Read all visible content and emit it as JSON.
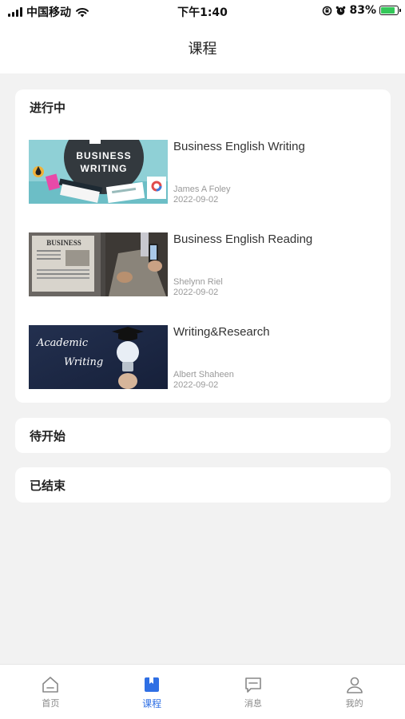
{
  "status_bar": {
    "carrier": "中国移动",
    "time": "下午1:40",
    "battery": "83%",
    "battery_level": 0.83,
    "icons": [
      "signal-icon",
      "wifi-icon",
      "rotation-lock-icon",
      "alarm-icon",
      "battery-charging-icon"
    ]
  },
  "header": {
    "title": "课程"
  },
  "sections": {
    "in_progress": {
      "title": "进行中",
      "courses": [
        {
          "title": "Business English Writing",
          "teacher": "James A Foley",
          "date": "2022-09-02",
          "thumb_text_1": "BUSINESS",
          "thumb_text_2": "WRITING"
        },
        {
          "title": "Business English Reading",
          "teacher": "Shelynn Riel",
          "date": "2022-09-02",
          "thumb_text_1": "BUSINESS"
        },
        {
          "title": "Writing&Research",
          "teacher": "Albert Shaheen",
          "date": "2022-09-02",
          "thumb_text_1": "Academic",
          "thumb_text_2": "Writing"
        }
      ]
    },
    "upcoming": {
      "title": "待开始"
    },
    "ended": {
      "title": "已结束"
    }
  },
  "tab_bar": {
    "items": [
      {
        "label": "首页",
        "icon": "home-icon"
      },
      {
        "label": "课程",
        "icon": "bookmark-book-icon",
        "active": true
      },
      {
        "label": "消息",
        "icon": "message-icon"
      },
      {
        "label": "我的",
        "icon": "profile-icon"
      }
    ]
  },
  "colors": {
    "accent": "#2f6fe4",
    "background": "#f2f2f2",
    "battery": "#34c759"
  }
}
